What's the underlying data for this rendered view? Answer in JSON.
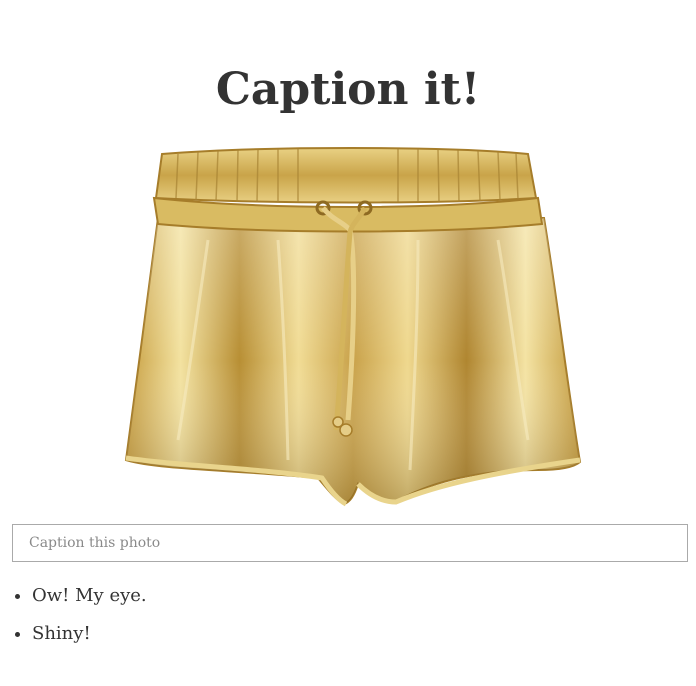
{
  "page": {
    "title": "Caption it!"
  },
  "photo": {
    "subject": "gold-shorts",
    "colors": {
      "highlight": "#f6e7a6",
      "mid": "#d4b04f",
      "shadow": "#9a7524"
    }
  },
  "caption_input": {
    "placeholder": "Caption this photo",
    "value": ""
  },
  "captions": [
    {
      "text": "Ow! My eye."
    },
    {
      "text": "Shiny!"
    }
  ]
}
